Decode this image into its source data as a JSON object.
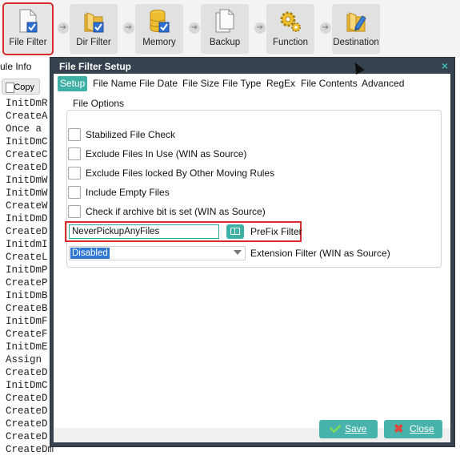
{
  "toolbar": {
    "items": [
      {
        "label": "File Filter",
        "icon": "file-filter-icon"
      },
      {
        "label": "Dir Filter",
        "icon": "folder-check-icon"
      },
      {
        "label": "Memory",
        "icon": "database-check-icon"
      },
      {
        "label": "Backup",
        "icon": "documents-icon"
      },
      {
        "label": "Function",
        "icon": "gear-icon"
      },
      {
        "label": "Destination",
        "icon": "destination-icon"
      }
    ],
    "selected_border_color": "#d92b2b"
  },
  "background": {
    "module_tab": "ule Info",
    "copy_label": "Copy",
    "log_lines": [
      "InitDmR",
      "CreateA",
      "Once a",
      "InitDmC",
      "CreateC",
      "CreateD",
      "InitDmW",
      "InitDmW",
      "CreateW",
      "InitDmD",
      "CreateD",
      "InitdmI",
      "CreateL",
      "InitDmP",
      "CreateP",
      "InitDmB",
      "CreateB",
      "InitDmF",
      "CreateF",
      "InitDmE",
      "Assign",
      "CreateD",
      "InitDmC",
      "CreateD",
      "CreateD",
      "CreateD",
      "CreateD",
      "CreateDmCommand( False )"
    ]
  },
  "dialog": {
    "title": "File Filter Setup",
    "close_glyph": "×",
    "tabs": [
      "Setup",
      "File Name",
      "File Date",
      "File Size",
      "File Type",
      "RegEx",
      "File Contents",
      "Advanced"
    ],
    "active_tab": "Setup",
    "accent_color": "#3fb0a6",
    "group_title": "File Options",
    "checkboxes": [
      {
        "label": "Stabilized File Check",
        "checked": false
      },
      {
        "label": "Exclude Files In Use (WIN as Source)",
        "checked": false
      },
      {
        "label": "Exclude Files locked By Other Moving Rules",
        "checked": false
      },
      {
        "label": "Include Empty Files",
        "checked": false
      },
      {
        "label": "Check if archive bit is set (WIN as Source)",
        "checked": false
      }
    ],
    "prefix_value": "NeverPickupAnyFiles",
    "prefix_label": "PreFix Filter",
    "extension_value": "Disabled",
    "extension_label": "Extension Filter (WIN as Source)",
    "save_label": "Save",
    "close_label": "Close"
  }
}
